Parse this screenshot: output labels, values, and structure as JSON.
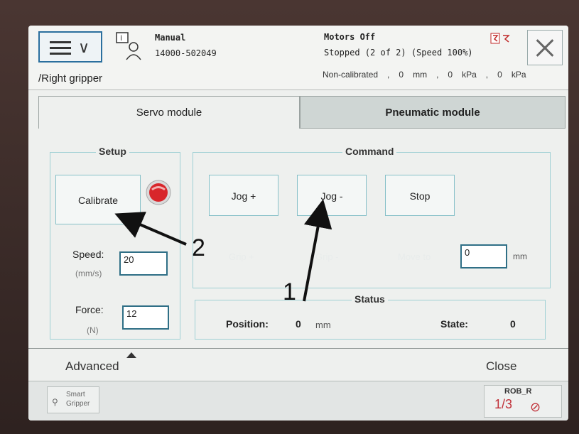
{
  "header": {
    "mode": "Manual",
    "serial": "14000-502049",
    "motors": "Motors Off",
    "state": "Stopped (2 of 2) (Speed 100%)",
    "path": "/Right gripper",
    "readout": [
      "Non-calibrated",
      ",",
      "0",
      "mm",
      ",",
      "0",
      "kPa",
      ",",
      "0",
      "kPa"
    ]
  },
  "tabs": {
    "servo": "Servo module",
    "pneumatic": "Pneumatic module"
  },
  "setup": {
    "title": "Setup",
    "calibrate": "Calibrate",
    "speed_label": "Speed:",
    "speed_unit": "(mm/s)",
    "speed_value": "20",
    "force_label": "Force:",
    "force_unit": "(N)",
    "force_value": "12"
  },
  "command": {
    "title": "Command",
    "jog_plus": "Jog +",
    "jog_minus": "Jog -",
    "stop": "Stop",
    "grip_plus": "Grip +",
    "grip_minus": "Grip -",
    "move_to": "Move to",
    "move_value": "0",
    "move_unit": "mm"
  },
  "status": {
    "title": "Status",
    "position_label": "Position:",
    "position_value": "0",
    "position_unit": "mm",
    "state_label": "State:",
    "state_value": "0"
  },
  "bottom": {
    "advanced": "Advanced",
    "close": "Close"
  },
  "taskbar": {
    "item_label": "Smart\nGripper",
    "robot": "ROB_R",
    "fraction": "1/3"
  },
  "annotations": {
    "one": "1",
    "two": "2"
  },
  "colors": {
    "accent": "#2b6f9e",
    "group_border": "#9fd0d4",
    "robot_icon": "#c03038"
  }
}
